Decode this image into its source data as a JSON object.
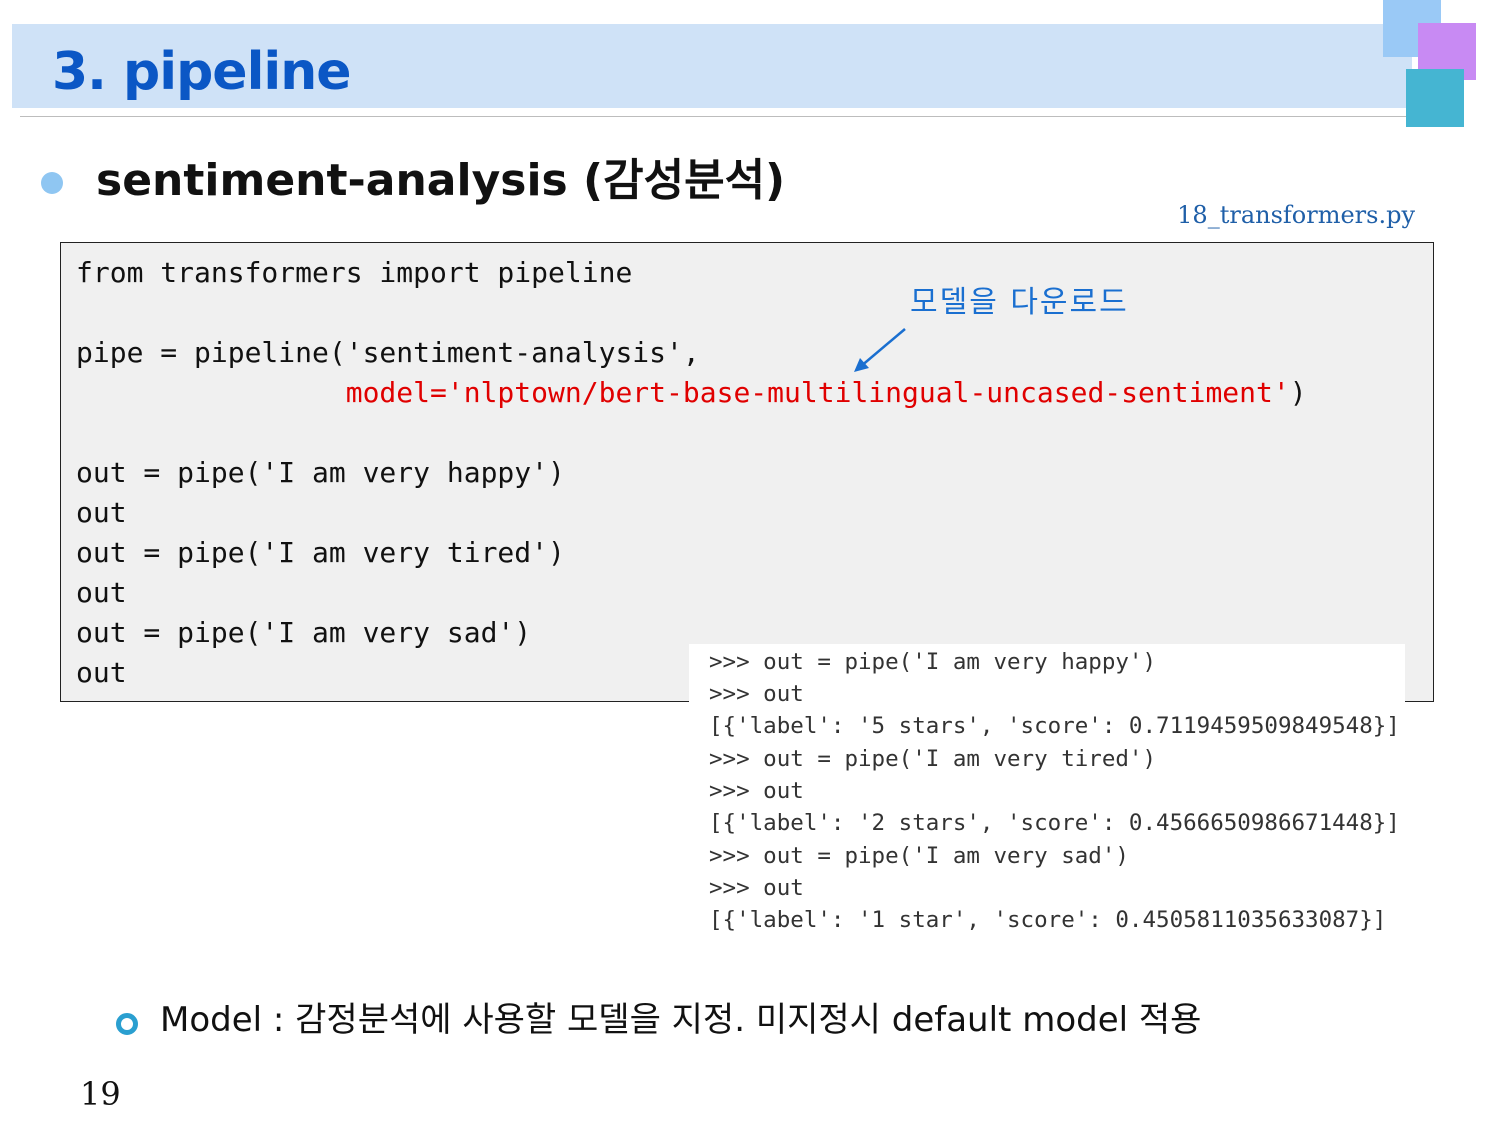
{
  "slide": {
    "title": "3. pipeline",
    "heading": "sentiment-analysis (감성분석)",
    "filename": "18_transformers.py",
    "page_number": "19",
    "note": "Model : 감정분석에 사용할 모델을 지정. 미지정시 default model 적용"
  },
  "code": {
    "lines": [
      "from transformers import pipeline",
      "",
      "pipe = pipeline('sentiment-analysis',",
      "                model='nlptown/bert-base-multilingual-uncased-sentiment')",
      "",
      "out = pipe('I am very happy')",
      "out",
      "out = pipe('I am very tired')",
      "out",
      "out = pipe('I am very sad')",
      "out"
    ],
    "line4_indent": "                ",
    "line4_highlight": "model='nlptown/bert-base-multilingual-uncased-sentiment'",
    "line4_tail": ")"
  },
  "annotation": {
    "text": "모델을 다운로드"
  },
  "output": {
    "lines": [
      ">>> out = pipe('I am very happy')",
      ">>> out",
      "[{'label': '5 stars', 'score': 0.7119459509849548}]",
      ">>> out = pipe('I am very tired')",
      ">>> out",
      "[{'label': '2 stars', 'score': 0.4566650986671448}]",
      ">>> out = pipe('I am very sad')",
      ">>> out",
      "[{'label': '1 star', 'score': 0.4505811035633087}]"
    ]
  },
  "colors": {
    "title": "#0b57c5",
    "title_bar": "#cfe2f7",
    "code_background": "#f0f0f0",
    "highlight_red": "#e00000",
    "annotation_blue": "#1a6fd0",
    "deco_light_blue": "#9ac9f6",
    "deco_purple": "#c88af3",
    "deco_teal": "#45b5d2"
  }
}
